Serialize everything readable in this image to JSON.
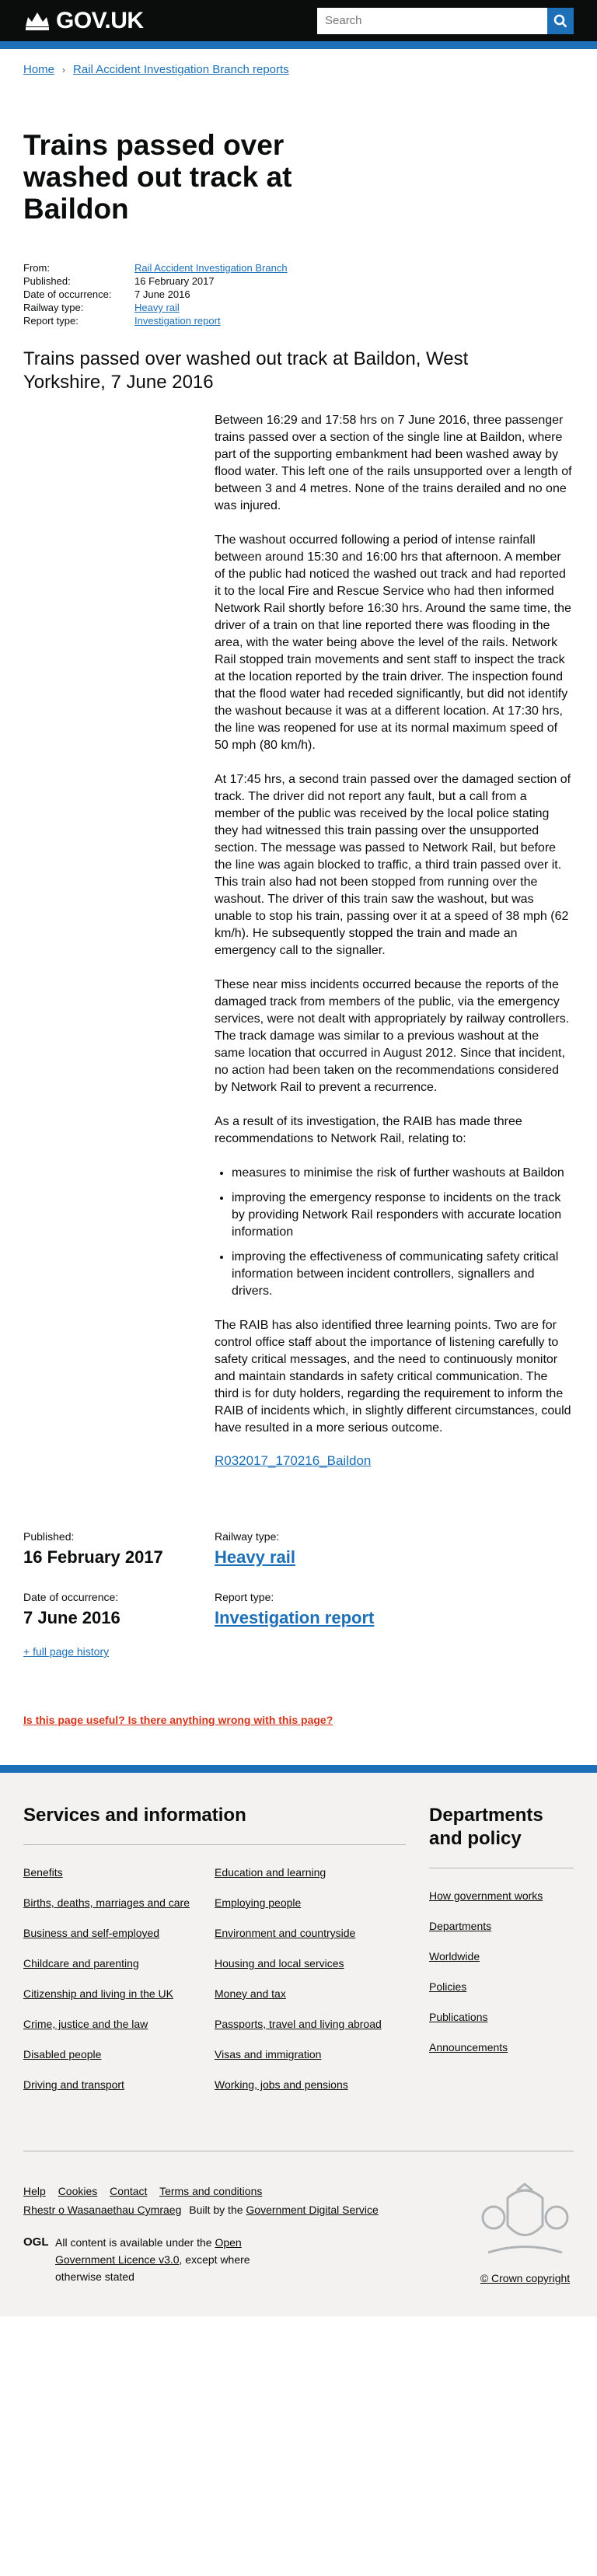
{
  "header": {
    "logo_text": "GOV.UK",
    "search_placeholder": "Search"
  },
  "breadcrumb": {
    "items": [
      "Home",
      "Rail Accident Investigation Branch reports"
    ]
  },
  "page": {
    "title": "Trains passed over washed out track at Baildon",
    "metadata": [
      {
        "label": "From:",
        "value": "Rail Accident Investigation Branch",
        "link": true
      },
      {
        "label": "Published:",
        "value": "16 February 2017",
        "link": false
      },
      {
        "label": "Date of occurrence:",
        "value": "7 June 2016",
        "link": false
      },
      {
        "label": "Railway type:",
        "value": "Heavy rail",
        "link": true
      },
      {
        "label": "Report type:",
        "value": "Investigation report",
        "link": true
      }
    ],
    "subtitle": "Trains passed over washed out track at Baildon, West Yorkshire, 7 June 2016"
  },
  "body": {
    "paragraphs": [
      "Between 16:29 and 17:58 hrs on 7 June 2016, three passenger trains passed over a section of the single line at Baildon, where part of the supporting embankment had been washed away by flood water. This left one of the rails unsupported over a length of between 3 and 4 metres. None of the trains derailed and no one was injured.",
      "The washout occurred following a period of intense rainfall between around 15:30 and 16:00 hrs that afternoon. A member of the public had noticed the washed out track and had reported it to the local Fire and Rescue Service who had then informed Network Rail shortly before 16:30 hrs. Around the same time, the driver of a train on that line reported there was flooding in the area, with the water being above the level of the rails. Network Rail stopped train movements and sent staff to inspect the track at the location reported by the train driver. The inspection found that the flood water had receded significantly, but did not identify the washout because it was at a different location. At 17:30 hrs, the line was reopened for use at its normal maximum speed of 50 mph (80 km/h).",
      "At 17:45 hrs, a second train passed over the damaged section of track. The driver did not report any fault, but a call from a member of the public was received by the local police stating they had witnessed this train passing over the unsupported section. The message was passed to Network Rail, but before the line was again blocked to traffic, a third train passed over it. This train also had not been stopped from running over the washout. The driver of this train saw the washout, but was unable to stop his train, passing over it at a speed of 38 mph (62 km/h). He subsequently stopped the train and made an emergency call to the signaller.",
      "These near miss incidents occurred because the reports of the damaged track from members of the public, via the emergency services, were not dealt with appropriately by railway controllers. The track damage was similar to a previous washout at the same location that occurred in August 2012. Since that incident, no action had been taken on the recommendations considered by Network Rail to prevent a recurrence.",
      "As a result of its investigation, the RAIB has made three recommendations to Network Rail, relating to:"
    ],
    "list": [
      "measures to minimise the risk of further washouts at Baildon",
      "improving the emergency response to incidents on the track by providing Network Rail responders with accurate location information",
      "improving the effectiveness of communicating safety critical information between incident controllers, signallers and drivers."
    ],
    "closing": "The RAIB has also identified three learning points. Two are for control office staff about the importance of listening carefully to safety critical messages, and the need to continuously monitor and maintain standards in safety critical communication. The third is for duty holders, regarding the requirement to inform the RAIB of incidents which, in slightly different circumstances, could have resulted in a more serious outcome.",
    "attachment": "R032017_170216_Baildon"
  },
  "bottom_meta": {
    "published_label": "Published:",
    "published_value": "16 February 2017",
    "railway_label": "Railway type:",
    "railway_value": "Heavy rail",
    "occurrence_label": "Date of occurrence:",
    "occurrence_value": "7 June 2016",
    "report_label": "Report type:",
    "report_value": "Investigation report",
    "full_history": "+ full page history"
  },
  "feedback": {
    "text": "Is this page useful? Is there anything wrong with this page?"
  },
  "footer": {
    "services_title": "Services and information",
    "services_col1": [
      "Benefits",
      "Births, deaths, marriages and care",
      "Business and self-employed",
      "Childcare and parenting",
      "Citizenship and living in the UK",
      "Crime, justice and the law",
      "Disabled people",
      "Driving and transport"
    ],
    "services_col2": [
      "Education and learning",
      "Employing people",
      "Environment and countryside",
      "Housing and local services",
      "Money and tax",
      "Passports, travel and living abroad",
      "Visas and immigration",
      "Working, jobs and pensions"
    ],
    "depts_title": "Departments and policy",
    "depts_links": [
      "How government works",
      "Departments",
      "Worldwide",
      "Policies",
      "Publications",
      "Announcements"
    ],
    "bottom_links": [
      "Help",
      "Cookies",
      "Contact",
      "Terms and conditions"
    ],
    "welsh": "Rhestr o Wasanaethau Cymraeg",
    "built_by_prefix": "Built by the ",
    "built_by_link": "Government Digital Service",
    "ogl_logo": "OGL",
    "licence_prefix": "All content is available under the ",
    "licence_link": "Open Government Licence v3.0",
    "licence_suffix": ", except where otherwise stated",
    "copyright": "© Crown copyright"
  }
}
